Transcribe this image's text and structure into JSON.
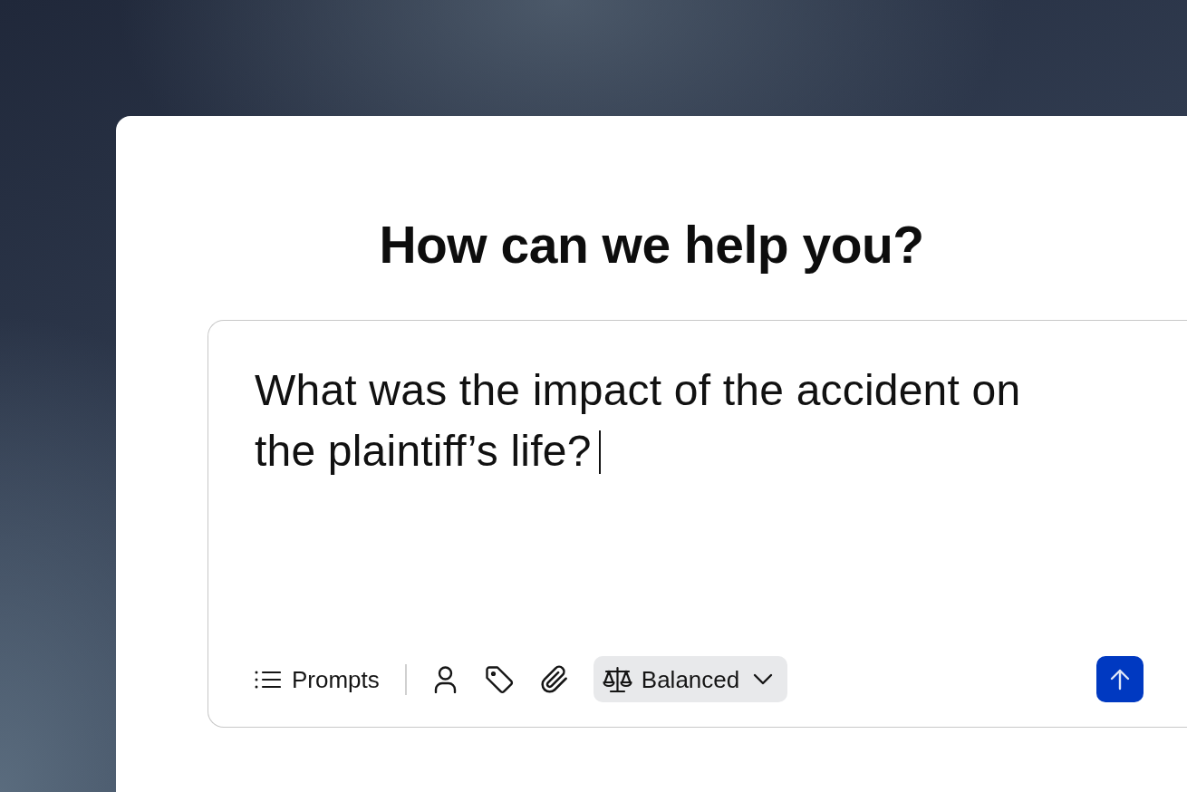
{
  "heading": "How can we help you?",
  "composer": {
    "value": "What was the impact of the accident on the plaintiff’s life?",
    "focused": true
  },
  "toolbar": {
    "prompts_button": {
      "label": "Prompts"
    },
    "mode_dropdown": {
      "label": "Balanced"
    }
  }
}
